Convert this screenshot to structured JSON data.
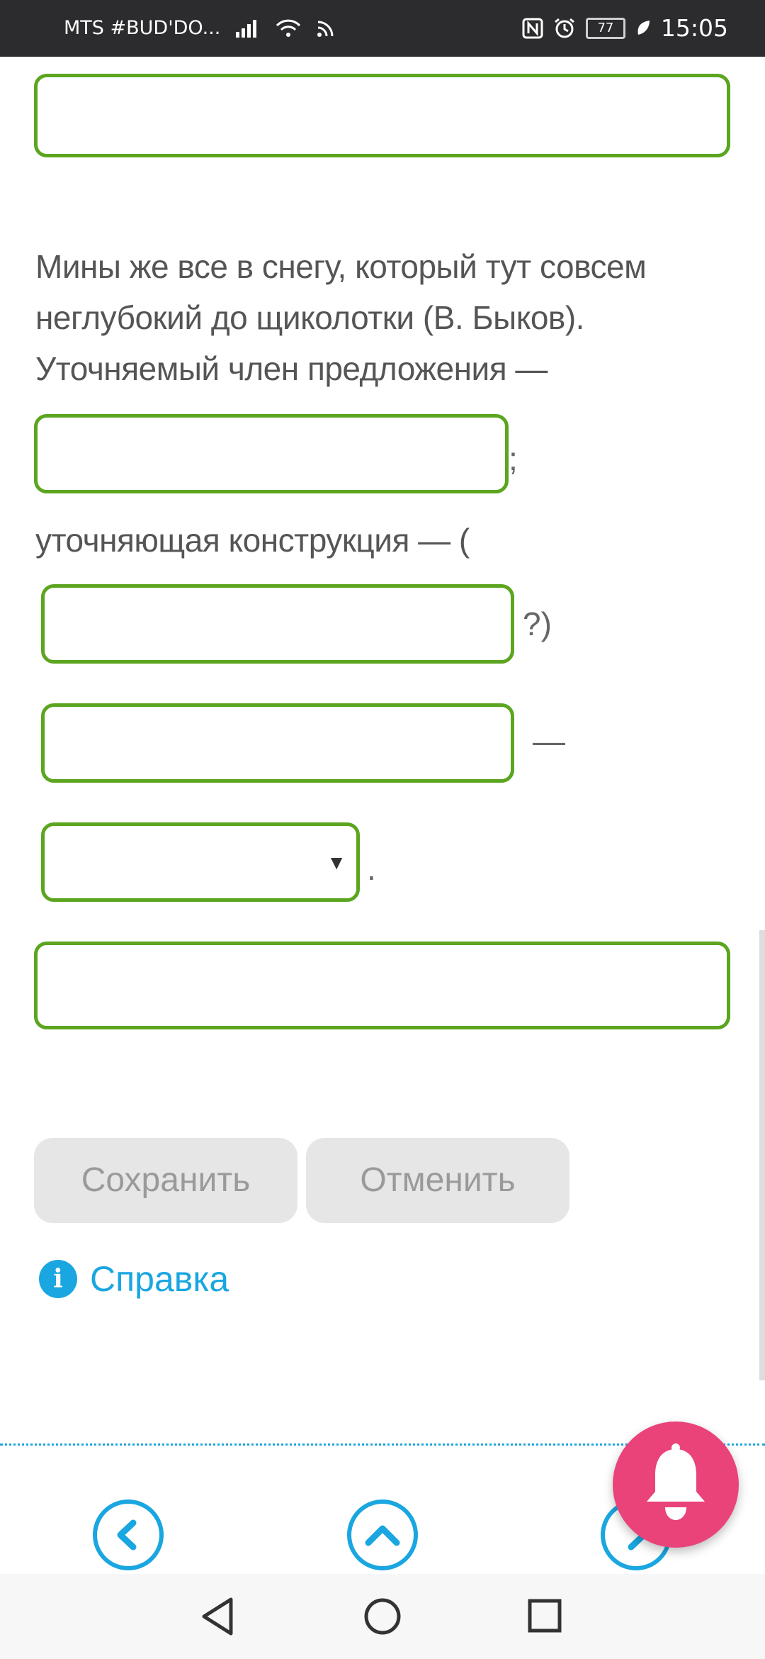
{
  "status_bar": {
    "carrier": "MTS #BUD'DO...",
    "battery": "77",
    "time": "15:05"
  },
  "question": {
    "sentence_line1": "Мины же все в снегу, который тут совсем",
    "sentence_line2": "неглубокий до щиколотки (В. Быков).",
    "sentence_line3": "Уточняемый член предложения —",
    "after_first_field": ";",
    "construction_label": "уточняющая конструкция — (",
    "after_second_field": "?)",
    "after_third_field": "—",
    "after_select": "."
  },
  "fields": {
    "top_answer": "",
    "clarified_member": "",
    "question_word": "",
    "construction": "",
    "select_value": "",
    "bottom_answer": ""
  },
  "actions": {
    "save_label": "Сохранить",
    "cancel_label": "Отменить",
    "help_label": "Справка",
    "help_icon_glyph": "i"
  },
  "colors": {
    "field_border": "#5ba51f",
    "link": "#1aa6e0",
    "bell_bg": "#e9437a",
    "button_bg": "#e6e6e6"
  },
  "icons": {
    "nav_prev": "chevron-left-icon",
    "nav_up": "chevron-up-icon",
    "nav_next": "chevron-right-icon",
    "notification": "bell-icon"
  }
}
